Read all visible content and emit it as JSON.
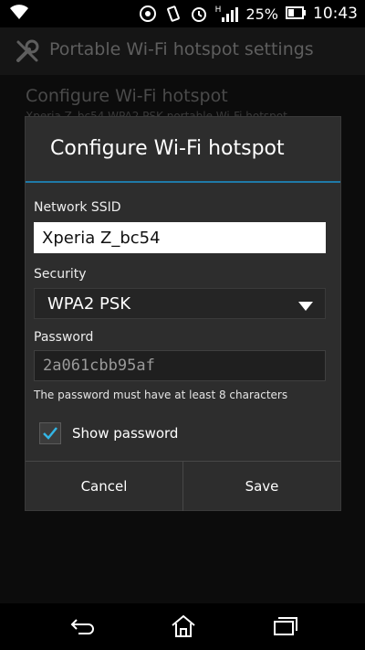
{
  "status_bar": {
    "battery_percent": "25%",
    "time": "10:43",
    "signal_type": "H",
    "icons": [
      "wifi-icon",
      "sync-icon",
      "vibrate-icon",
      "alarm-icon",
      "signal-icon",
      "battery-icon"
    ]
  },
  "action_bar": {
    "title": "Portable Wi-Fi hotspot settings",
    "icon": "wrench-icon"
  },
  "background_list": {
    "item_title": "Configure Wi-Fi hotspot",
    "item_subtitle": "Xperia Z_bc54 WPA2 PSK portable Wi-Fi hotspot"
  },
  "dialog": {
    "title": "Configure Wi-Fi hotspot",
    "ssid_label": "Network SSID",
    "ssid_value": "Xperia Z_bc54",
    "security_label": "Security",
    "security_value": "WPA2 PSK",
    "password_label": "Password",
    "password_value": "2a061cbb95af",
    "password_hint": "The password must have at least 8 characters",
    "show_password_label": "Show password",
    "show_password_checked": true,
    "cancel_label": "Cancel",
    "save_label": "Save"
  },
  "colors": {
    "accent": "#1f7aa8",
    "check": "#33b5e5"
  }
}
